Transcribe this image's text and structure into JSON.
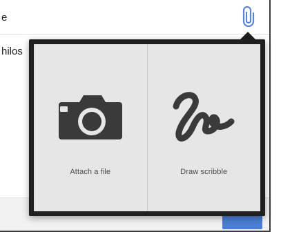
{
  "background": {
    "topbar_text": "e",
    "body_text": "hilos"
  },
  "popover": {
    "options": [
      {
        "label": "Attach a file",
        "icon": "camera-icon"
      },
      {
        "label": "Draw scribble",
        "icon": "scribble-icon"
      }
    ]
  },
  "colors": {
    "popover_frame": "#1f1f1f",
    "panel": "#e6e6e6",
    "attach_icon": "#5a86d1",
    "icon_dark": "#3a3a3a"
  }
}
